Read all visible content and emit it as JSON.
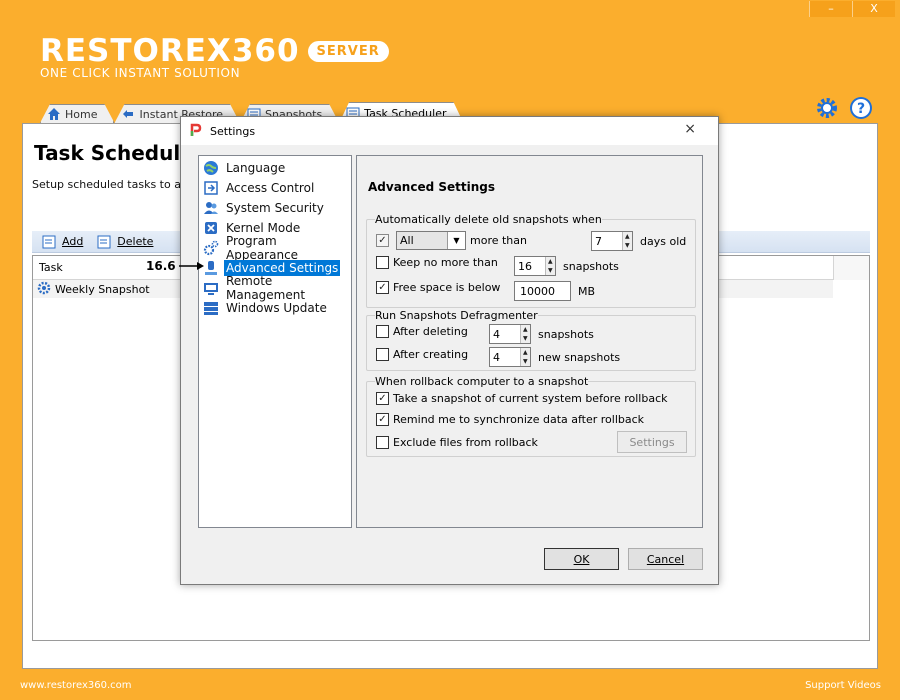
{
  "window": {
    "minimize": "–",
    "close": "X"
  },
  "brand": {
    "name": "RESTOREX360",
    "badge": "SERVER",
    "tagline": "ONE CLICK INSTANT SOLUTION"
  },
  "tabs": [
    {
      "label": "Home",
      "icon": "home-icon"
    },
    {
      "label": "Instant Restore",
      "icon": "restore-icon"
    },
    {
      "label": "Snapshots",
      "icon": "snapshots-icon"
    },
    {
      "label": "Task Scheduler",
      "icon": "scheduler-icon"
    }
  ],
  "page": {
    "title": "Task Scheduler",
    "description": "Setup scheduled tasks to autor"
  },
  "toolbar": {
    "add": "Add",
    "delete": "Delete"
  },
  "grid": {
    "column": "Task",
    "rows": [
      {
        "name": "Weekly Snapshot"
      }
    ]
  },
  "annotation": {
    "value": "16.6"
  },
  "footer": {
    "website": "www.restorex360.com",
    "support": "Support Videos"
  },
  "dialog": {
    "title": "Settings",
    "close": "×",
    "nav": [
      {
        "label": "Language",
        "icon": "globe-icon"
      },
      {
        "label": "Access Control",
        "icon": "access-icon"
      },
      {
        "label": "System Security",
        "icon": "users-icon"
      },
      {
        "label": "Kernel Mode",
        "icon": "kernel-icon"
      },
      {
        "label": "Program Appearance",
        "icon": "gears-icon"
      },
      {
        "label": "Advanced Settings",
        "icon": "advanced-icon",
        "selected": true
      },
      {
        "label": "Remote Management",
        "icon": "remote-icon"
      },
      {
        "label": "Windows Update",
        "icon": "update-icon"
      }
    ],
    "content": {
      "title": "Advanced Settings",
      "group1": {
        "title": "Automatically delete old snapshots when",
        "all_select": "All",
        "more_than": "more than",
        "days_value": "7",
        "days_old": "days old",
        "keep_label": "Keep no more than",
        "keep_value": "16",
        "keep_unit": "snapshots",
        "free_label": "Free space is below",
        "free_value": "10000",
        "free_unit": "MB"
      },
      "group2": {
        "title": "Run Snapshots Defragmenter",
        "after_deleting": "After deleting",
        "deleting_value": "4",
        "deleting_unit": "snapshots",
        "after_creating": "After creating",
        "creating_value": "4",
        "creating_unit": "new snapshots"
      },
      "group3": {
        "title": "When rollback computer to a snapshot",
        "take_snapshot": "Take a snapshot of current system before rollback",
        "remind_sync": "Remind me to synchronize data after rollback",
        "exclude_files": "Exclude files from rollback",
        "settings_button": "Settings"
      }
    },
    "ok": "OK",
    "cancel": "Cancel"
  }
}
